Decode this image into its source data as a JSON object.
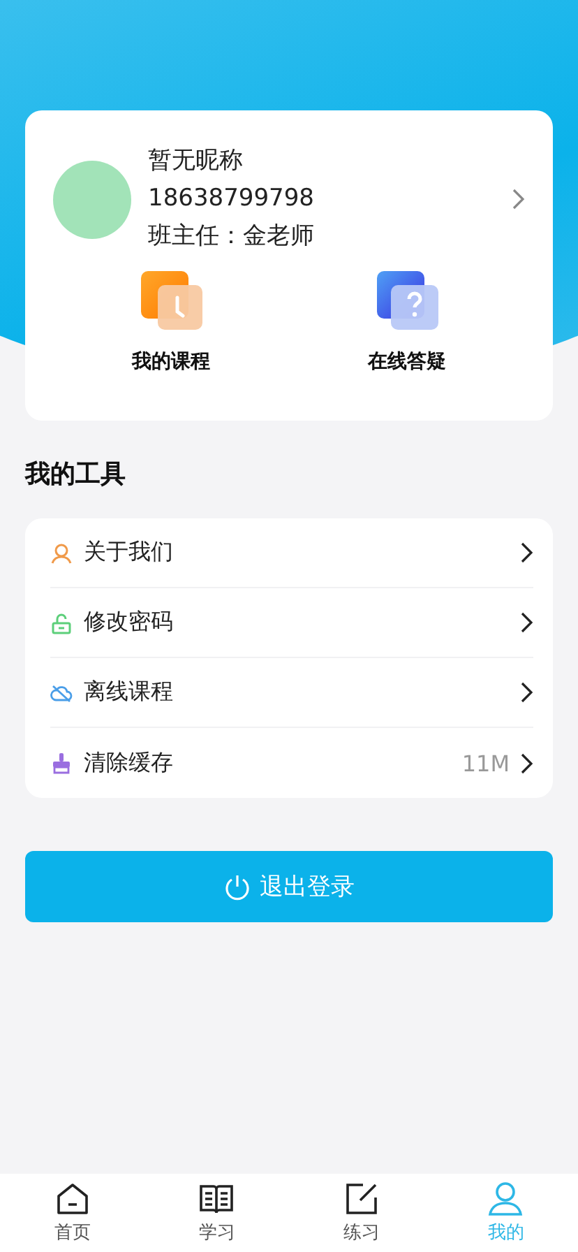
{
  "profile": {
    "nickname": "暂无昵称",
    "phone": "18638799798",
    "teacher": "班主任：金老师",
    "shortcuts": [
      {
        "kind": "course",
        "label": "我的课程"
      },
      {
        "kind": "question",
        "label": "在线答疑"
      }
    ]
  },
  "tools": {
    "title": "我的工具",
    "items": [
      {
        "kind": "about",
        "label": "关于我们"
      },
      {
        "kind": "password",
        "label": "修改密码"
      },
      {
        "kind": "offline",
        "label": "离线课程"
      },
      {
        "kind": "cache",
        "label": "清除缓存",
        "value": "11M"
      }
    ]
  },
  "logout": {
    "label": "退出登录"
  },
  "tabbar": [
    {
      "kind": "home",
      "label": "首页",
      "selected": false
    },
    {
      "kind": "study",
      "label": "学习",
      "selected": false
    },
    {
      "kind": "practice",
      "label": "练习",
      "selected": false
    },
    {
      "kind": "mine",
      "label": "我的",
      "selected": true
    }
  ]
}
